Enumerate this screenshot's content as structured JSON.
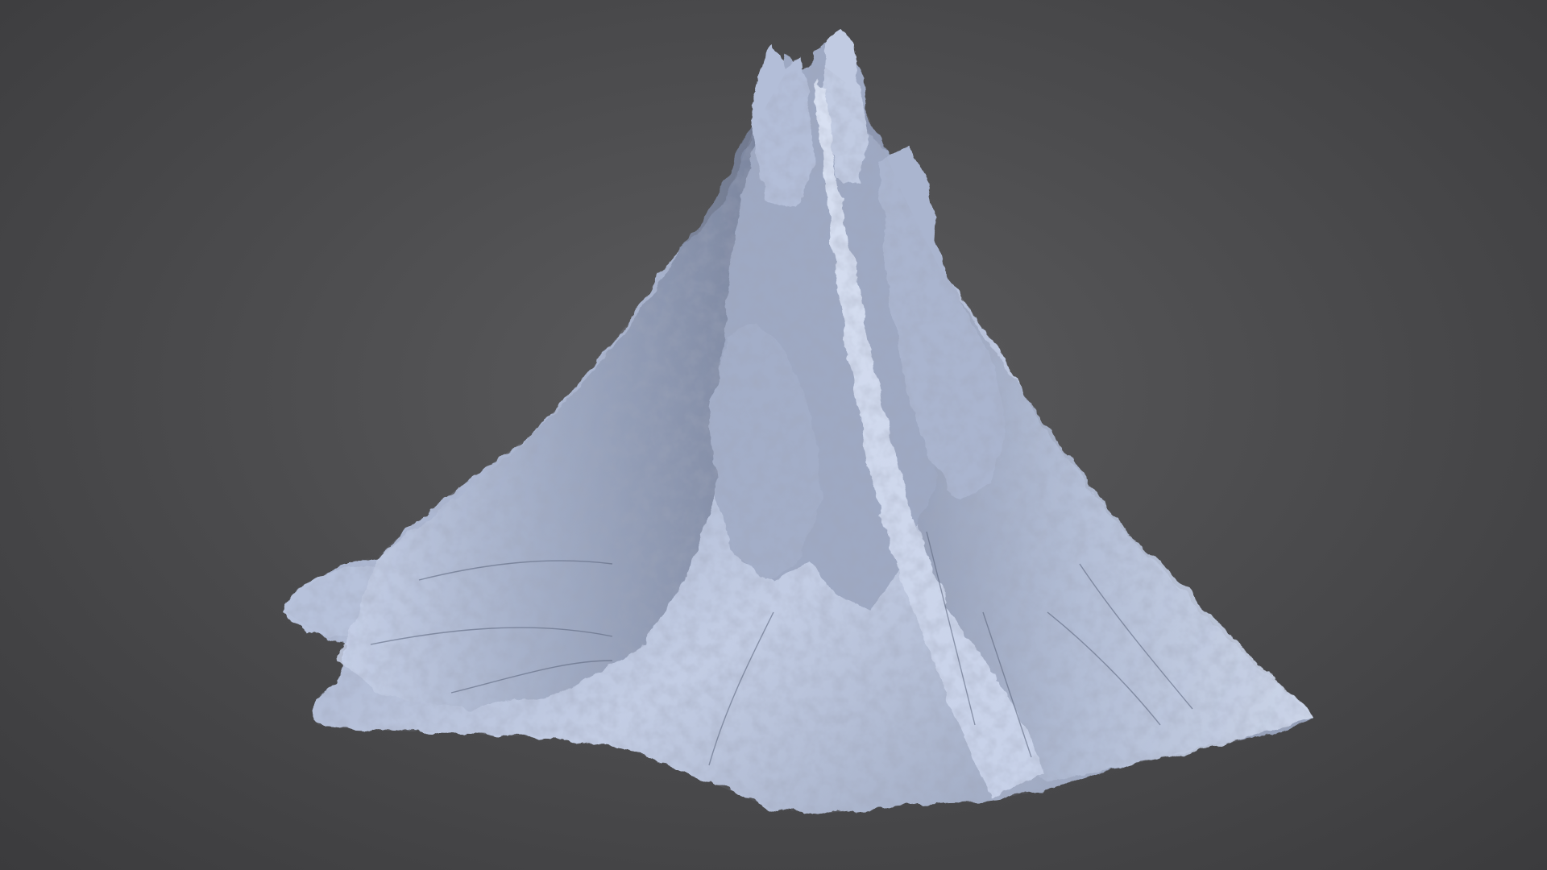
{
  "viewport": {
    "background_color": "#4e4e50",
    "model": {
      "kind": "sculpted-mountain-mesh",
      "material_color": "#b8c3dd",
      "highlight_color": "#e6ecf8",
      "shadow_color": "#5a6378"
    }
  }
}
